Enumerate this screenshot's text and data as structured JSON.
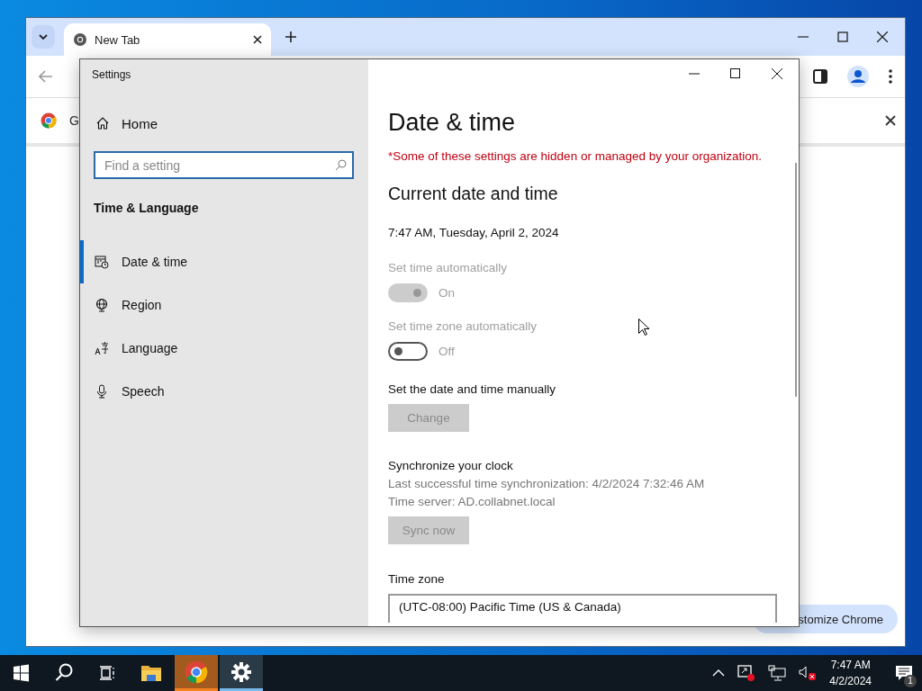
{
  "browser": {
    "tabs": [
      {
        "label": "New Tab",
        "selected": true
      }
    ],
    "bookmark_text": "G",
    "customize_button": "stomize Chrome"
  },
  "settings": {
    "title": "Settings",
    "nav": {
      "home": "Home",
      "search": {
        "placeholder": "Find a setting"
      },
      "section": "Time & Language",
      "items": [
        {
          "label": "Date & time",
          "kind": "calendar",
          "selected": true
        },
        {
          "label": "Region",
          "kind": "globe",
          "selected": false
        },
        {
          "label": "Language",
          "kind": "language",
          "selected": false
        },
        {
          "label": "Speech",
          "kind": "mic",
          "selected": false
        }
      ]
    },
    "heading": "Date & time",
    "warning": "*Some of these settings are hidden or managed by your organization.",
    "subheading": "Current date and time",
    "current": "7:47 AM, Tuesday, April 2, 2024",
    "toggles": [
      {
        "label": "Set time automatically",
        "on": true,
        "disabled": true,
        "state_text": "On"
      },
      {
        "label": "Set time zone automatically",
        "on": false,
        "disabled": true,
        "state_text": "Off"
      }
    ],
    "manual": {
      "label": "Set the date and time manually",
      "button": "Change",
      "disabled": true
    },
    "sync": {
      "heading": "Synchronize your clock",
      "lines": [
        "Last successful time synchronization: 4/2/2024 7:32:46 AM",
        "Time server: AD.collabnet.local"
      ],
      "button": "Sync now",
      "disabled": true
    },
    "timezone": {
      "label": "Time zone",
      "value": "(UTC-08:00) Pacific Time (US & Canada)"
    }
  },
  "taskbar": {
    "apps": [
      {
        "kind": "explorer",
        "flashing": false,
        "selected": false
      },
      {
        "kind": "chrome",
        "flashing": true,
        "selected": false
      },
      {
        "kind": "settings",
        "flashing": false,
        "selected": true
      }
    ],
    "time": "7:47 AM",
    "date": "4/2/2024",
    "notifications": "1"
  }
}
